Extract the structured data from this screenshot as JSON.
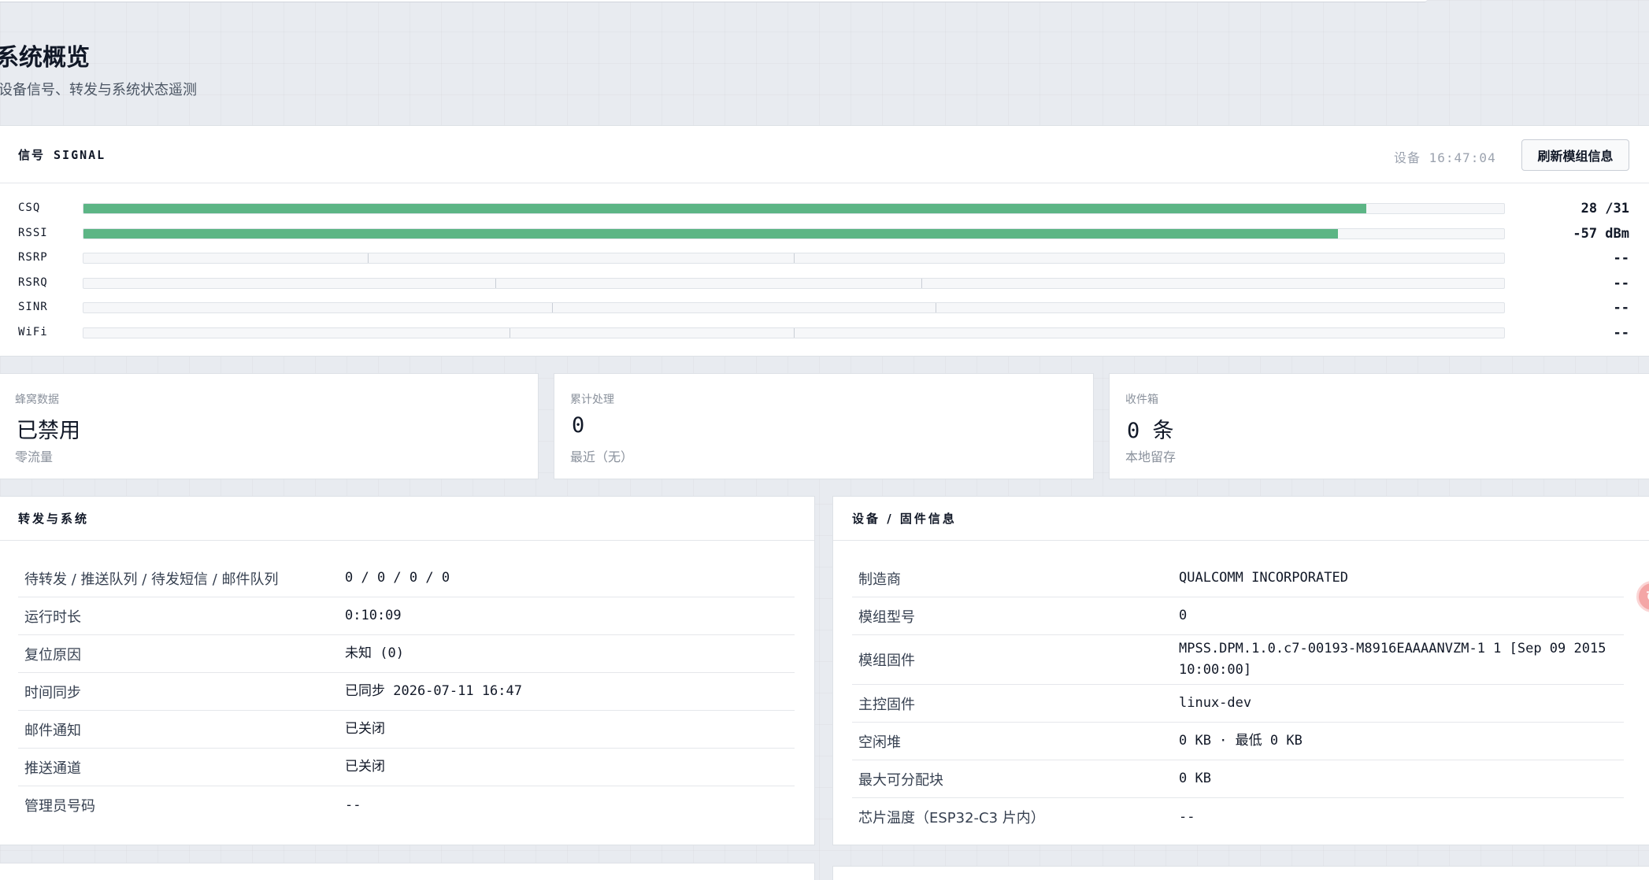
{
  "page": {
    "title": "系统概览",
    "subtitle": "设备信号、转发与系统状态遥测"
  },
  "signal": {
    "title": "信号 SIGNAL",
    "device_time": "设备 16:47:04",
    "refresh_label": "刷新模组信息",
    "rows": [
      {
        "label": "CSQ",
        "value": "28 /31",
        "fill_fraction": 0.903,
        "ticks": []
      },
      {
        "label": "RSSI",
        "value": "-57 dBm",
        "fill_fraction": 0.883,
        "ticks": []
      },
      {
        "label": "RSRP",
        "value": "--",
        "fill_fraction": 0,
        "ticks": [
          0.2,
          0.5
        ]
      },
      {
        "label": "RSRQ",
        "value": "--",
        "fill_fraction": 0,
        "ticks": [
          0.29,
          0.59
        ]
      },
      {
        "label": "SINR",
        "value": "--",
        "fill_fraction": 0,
        "ticks": [
          0.33,
          0.6
        ]
      },
      {
        "label": "WiFi",
        "value": "--",
        "fill_fraction": 0,
        "ticks": [
          0.3,
          0.5
        ]
      }
    ]
  },
  "stats": [
    {
      "label": "蜂窝数据",
      "value": "已禁用",
      "sub": "零流量"
    },
    {
      "label": "累计处理",
      "value": "0",
      "sub": "最近（无）"
    },
    {
      "label": "收件箱",
      "value": "0 条",
      "sub": "本地留存"
    }
  ],
  "forwarding": {
    "title": "转发与系统",
    "rows": [
      {
        "key": "待转发 / 推送队列 / 待发短信 / 邮件队列",
        "value": "0 / 0 / 0 / 0"
      },
      {
        "key": "运行时长",
        "value": "0:10:09"
      },
      {
        "key": "复位原因",
        "value": "未知 (0)"
      },
      {
        "key": "时间同步",
        "value": "已同步 2026-07-11 16:47"
      },
      {
        "key": "邮件通知",
        "value": "已关闭"
      },
      {
        "key": "推送通道",
        "value": "已关闭"
      },
      {
        "key": "管理员号码",
        "value": "--"
      }
    ]
  },
  "device": {
    "title": "设备 / 固件信息",
    "rows": [
      {
        "key": "制造商",
        "value": "QUALCOMM INCORPORATED"
      },
      {
        "key": "模组型号",
        "value": "0"
      },
      {
        "key": "模组固件",
        "value": "MPSS.DPM.1.0.c7-00193-M8916EAAAANVZM-1 1 [Sep 09 2015 10:00:00]"
      },
      {
        "key": "主控固件",
        "value": "linux-dev"
      },
      {
        "key": "空闲堆",
        "value": "0 KB · 最低 0 KB"
      },
      {
        "key": "最大可分配块",
        "value": "0 KB"
      },
      {
        "key": "芯片温度（ESP32-C3 片内）",
        "value": "--"
      }
    ]
  },
  "colors": {
    "bar_fill": "#5cb585",
    "float_button": "#f4a6a6"
  },
  "icons": {
    "float_button": "refresh-icon"
  }
}
